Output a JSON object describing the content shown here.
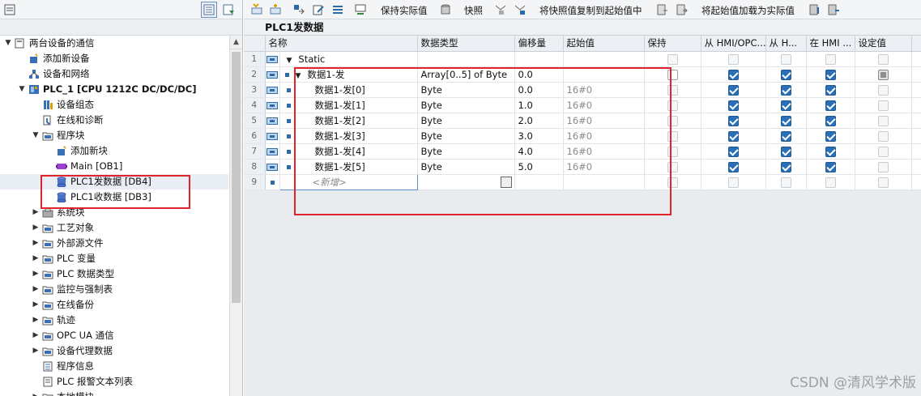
{
  "tree": {
    "items": [
      {
        "id": "project",
        "label": "两台设备的通信",
        "arrow": "▼",
        "indent": 0,
        "icon": "project-icon"
      },
      {
        "id": "add-device",
        "label": "添加新设备",
        "arrow": "",
        "indent": 1,
        "icon": "add-device-icon"
      },
      {
        "id": "devices-networks",
        "label": "设备和网络",
        "arrow": "",
        "indent": 1,
        "icon": "network-icon"
      },
      {
        "id": "plc1",
        "label": "PLC_1 [CPU 1212C DC/DC/DC]",
        "arrow": "▼",
        "indent": 1,
        "icon": "plc-icon",
        "bold": true
      },
      {
        "id": "device-config",
        "label": "设备组态",
        "arrow": "",
        "indent": 2,
        "icon": "device-config-icon"
      },
      {
        "id": "online-diag",
        "label": "在线和诊断",
        "arrow": "",
        "indent": 2,
        "icon": "diagnostics-icon"
      },
      {
        "id": "program-blocks",
        "label": "程序块",
        "arrow": "▼",
        "indent": 2,
        "icon": "folder-icon"
      },
      {
        "id": "add-block",
        "label": "添加新块",
        "arrow": "",
        "indent": 3,
        "icon": "add-block-icon"
      },
      {
        "id": "main-ob1",
        "label": "Main [OB1]",
        "arrow": "",
        "indent": 3,
        "icon": "ob-block-icon"
      },
      {
        "id": "plc1-send",
        "label": "PLC1发数据 [DB4]",
        "arrow": "",
        "indent": 3,
        "icon": "db-icon",
        "highlight": true
      },
      {
        "id": "plc1-recv",
        "label": "PLC1收数据 [DB3]",
        "arrow": "",
        "indent": 3,
        "icon": "db-icon"
      },
      {
        "id": "system-blocks",
        "label": "系统块",
        "arrow": "▶",
        "indent": 2,
        "icon": "system-blocks-icon"
      },
      {
        "id": "tech-objects",
        "label": "工艺对象",
        "arrow": "▶",
        "indent": 2,
        "icon": "folder-icon"
      },
      {
        "id": "external-sources",
        "label": "外部源文件",
        "arrow": "▶",
        "indent": 2,
        "icon": "folder-icon"
      },
      {
        "id": "plc-tags",
        "label": "PLC 变量",
        "arrow": "▶",
        "indent": 2,
        "icon": "folder-icon"
      },
      {
        "id": "plc-datatypes",
        "label": "PLC 数据类型",
        "arrow": "▶",
        "indent": 2,
        "icon": "folder-icon"
      },
      {
        "id": "watch-force",
        "label": "监控与强制表",
        "arrow": "▶",
        "indent": 2,
        "icon": "folder-icon"
      },
      {
        "id": "online-backup",
        "label": "在线备份",
        "arrow": "▶",
        "indent": 2,
        "icon": "folder-icon"
      },
      {
        "id": "traces",
        "label": "轨迹",
        "arrow": "▶",
        "indent": 2,
        "icon": "folder-icon"
      },
      {
        "id": "opc-ua",
        "label": "OPC UA 通信",
        "arrow": "▶",
        "indent": 2,
        "icon": "folder-icon"
      },
      {
        "id": "proxy-data",
        "label": "设备代理数据",
        "arrow": "▶",
        "indent": 2,
        "icon": "folder-icon"
      },
      {
        "id": "program-info",
        "label": "程序信息",
        "arrow": "",
        "indent": 2,
        "icon": "program-info-icon"
      },
      {
        "id": "plc-alarms",
        "label": "PLC 报警文本列表",
        "arrow": "",
        "indent": 2,
        "icon": "alarm-list-icon"
      },
      {
        "id": "local-modules",
        "label": "本地模块",
        "arrow": "▶",
        "indent": 2,
        "icon": "folder-icon"
      }
    ]
  },
  "toolbar": {
    "keep_actual": "保持实际值",
    "snapshot": "快照",
    "copy_snapshot_to_start": "将快照值复制到起始值中",
    "load_start_as_actual": "将起始值加载为实际值"
  },
  "editor": {
    "title": "PLC1发数据",
    "columns": [
      "名称",
      "数据类型",
      "偏移量",
      "起始值",
      "保持",
      "从 HMI/OPC...",
      "从 H...",
      "在 HMI ...",
      "设定值"
    ],
    "rows": [
      {
        "n": "1",
        "name": "Static",
        "type": "",
        "offset": "",
        "start": "",
        "expand": "▼",
        "indent": 0,
        "retain": "dis",
        "hmi1": "dis",
        "hmi2": "dis",
        "hmi3": "dis",
        "set": "dis"
      },
      {
        "n": "2",
        "name": "数据1-发",
        "type": "Array[0..5] of Byte",
        "offset": "0.0",
        "start": "",
        "expand": "▼",
        "indent": 1,
        "retain": "off",
        "hmi1": "on",
        "hmi2": "on",
        "hmi3": "on",
        "set": "ind"
      },
      {
        "n": "3",
        "name": "数据1-发[0]",
        "type": "Byte",
        "offset": "0.0",
        "start": "16#0",
        "expand": "",
        "indent": 2,
        "retain": "dis",
        "hmi1": "on",
        "hmi2": "on",
        "hmi3": "on",
        "set": "dis"
      },
      {
        "n": "4",
        "name": "数据1-发[1]",
        "type": "Byte",
        "offset": "1.0",
        "start": "16#0",
        "expand": "",
        "indent": 2,
        "retain": "dis",
        "hmi1": "on",
        "hmi2": "on",
        "hmi3": "on",
        "set": "dis"
      },
      {
        "n": "5",
        "name": "数据1-发[2]",
        "type": "Byte",
        "offset": "2.0",
        "start": "16#0",
        "expand": "",
        "indent": 2,
        "retain": "dis",
        "hmi1": "on",
        "hmi2": "on",
        "hmi3": "on",
        "set": "dis"
      },
      {
        "n": "6",
        "name": "数据1-发[3]",
        "type": "Byte",
        "offset": "3.0",
        "start": "16#0",
        "expand": "",
        "indent": 2,
        "retain": "dis",
        "hmi1": "on",
        "hmi2": "on",
        "hmi3": "on",
        "set": "dis"
      },
      {
        "n": "7",
        "name": "数据1-发[4]",
        "type": "Byte",
        "offset": "4.0",
        "start": "16#0",
        "expand": "",
        "indent": 2,
        "retain": "dis",
        "hmi1": "on",
        "hmi2": "on",
        "hmi3": "on",
        "set": "dis"
      },
      {
        "n": "8",
        "name": "数据1-发[5]",
        "type": "Byte",
        "offset": "5.0",
        "start": "16#0",
        "expand": "",
        "indent": 2,
        "retain": "dis",
        "hmi1": "on",
        "hmi2": "on",
        "hmi3": "on",
        "set": "dis"
      }
    ],
    "new_row": {
      "n": "9",
      "placeholder": "<新增>"
    }
  },
  "watermark": "CSDN @清风学术版",
  "colors": {
    "accent": "#2b6fb7",
    "highlight_box": "#e0242e",
    "header_bg": "#eceff3"
  }
}
